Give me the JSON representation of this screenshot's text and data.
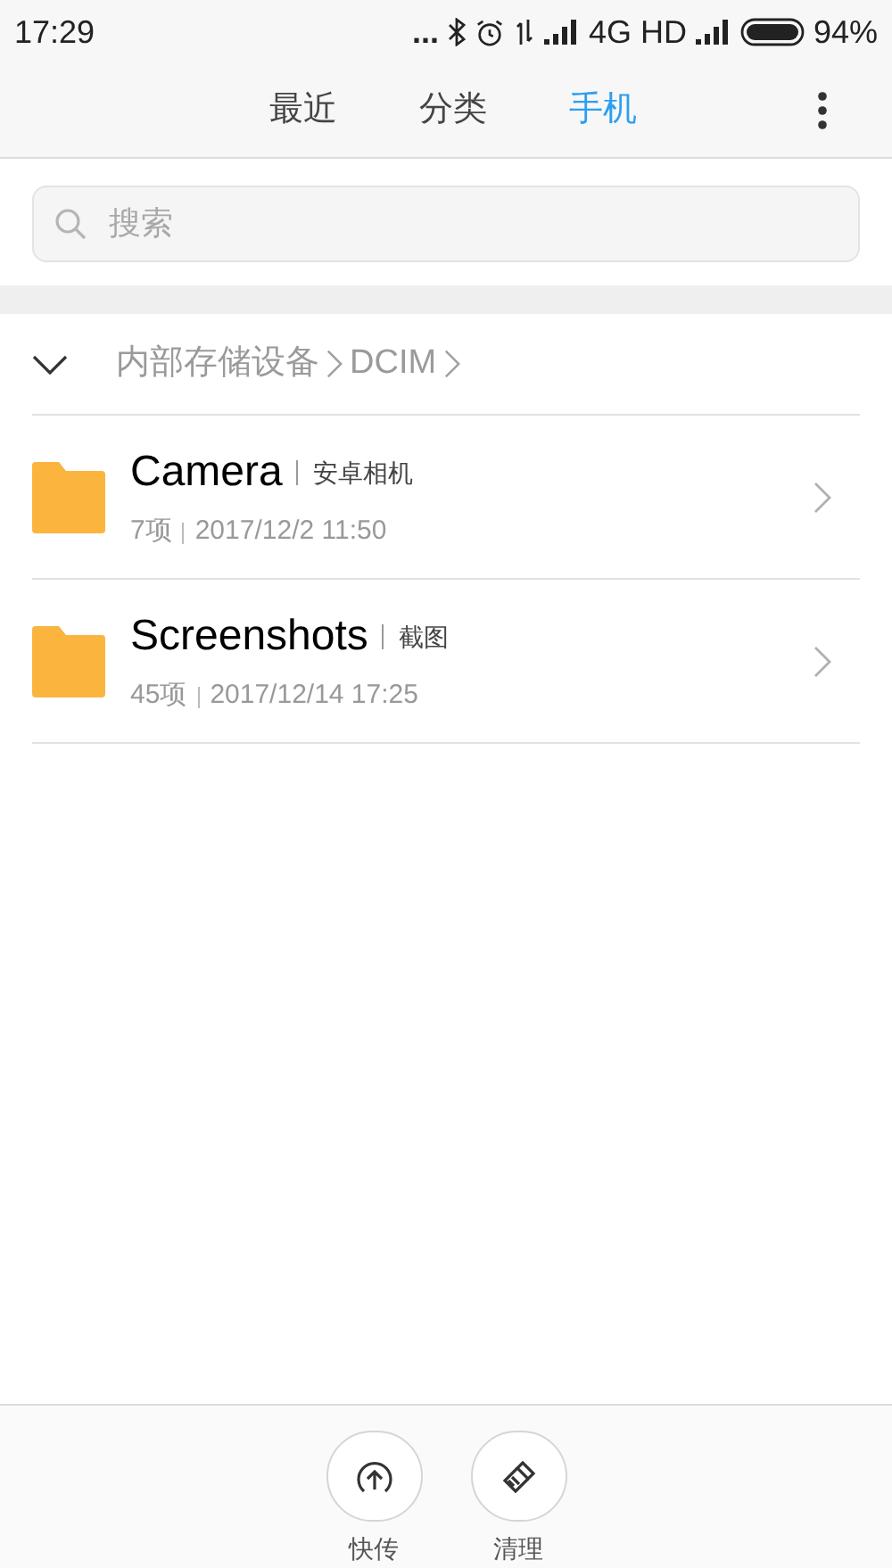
{
  "status_bar": {
    "time": "17:29",
    "dots": "...",
    "network": "4G HD",
    "battery": "94%"
  },
  "tabs": [
    {
      "label": "最近",
      "selected": false
    },
    {
      "label": "分类",
      "selected": false
    },
    {
      "label": "手机",
      "selected": true
    }
  ],
  "search": {
    "placeholder": "搜索"
  },
  "breadcrumb": [
    "内部存储设备",
    "DCIM"
  ],
  "folders": [
    {
      "name": "Camera",
      "alias": "安卓相机",
      "count": "7项",
      "date": "2017/12/2 11:50"
    },
    {
      "name": "Screenshots",
      "alias": "截图",
      "count": "45项",
      "date": "2017/12/14 17:25"
    }
  ],
  "actions": [
    {
      "kind": "transfer",
      "label": "快传"
    },
    {
      "kind": "clean",
      "label": "清理"
    }
  ]
}
